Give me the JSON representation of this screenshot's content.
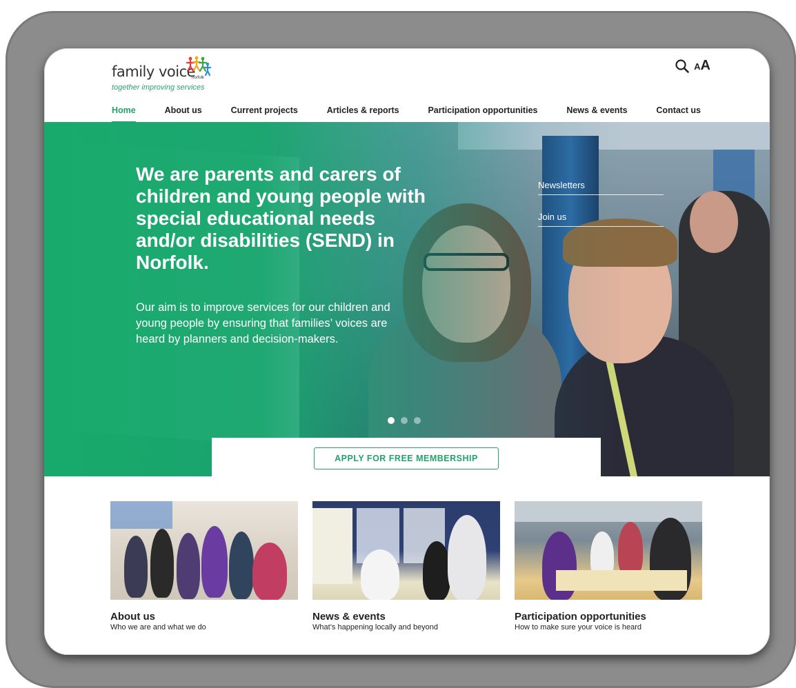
{
  "logo": {
    "name": "family voice",
    "sub": "norfolk",
    "tagline": "together improving services"
  },
  "tools": {
    "text_small": "A",
    "text_large": "A"
  },
  "nav": [
    {
      "label": "Home",
      "active": true
    },
    {
      "label": "About us"
    },
    {
      "label": "Current projects"
    },
    {
      "label": "Articles & reports"
    },
    {
      "label": "Participation opportunities"
    },
    {
      "label": "News & events"
    },
    {
      "label": "Contact us"
    }
  ],
  "hero": {
    "title": "We are parents and carers of children and young people with special educational needs and/or disabilities (SEND) in Norfolk.",
    "text": "Our aim is to improve services for our children and young people by ensuring that families’ voices are heard by planners and decision-makers.",
    "side_links": [
      "Newsletters",
      "Join us"
    ],
    "slides": 3,
    "active_slide": 1,
    "cta": "APPLY FOR FREE MEMBERSHIP"
  },
  "cards": [
    {
      "title": "About us",
      "desc": "Who we are and what we do"
    },
    {
      "title": "News & events",
      "desc": "What’s happening locally and beyond"
    },
    {
      "title": "Participation opportunities",
      "desc": "How to make sure your voice is heard"
    }
  ],
  "colors": {
    "brand_green": "#22a36a",
    "frame_gray": "#8c8c8c"
  }
}
